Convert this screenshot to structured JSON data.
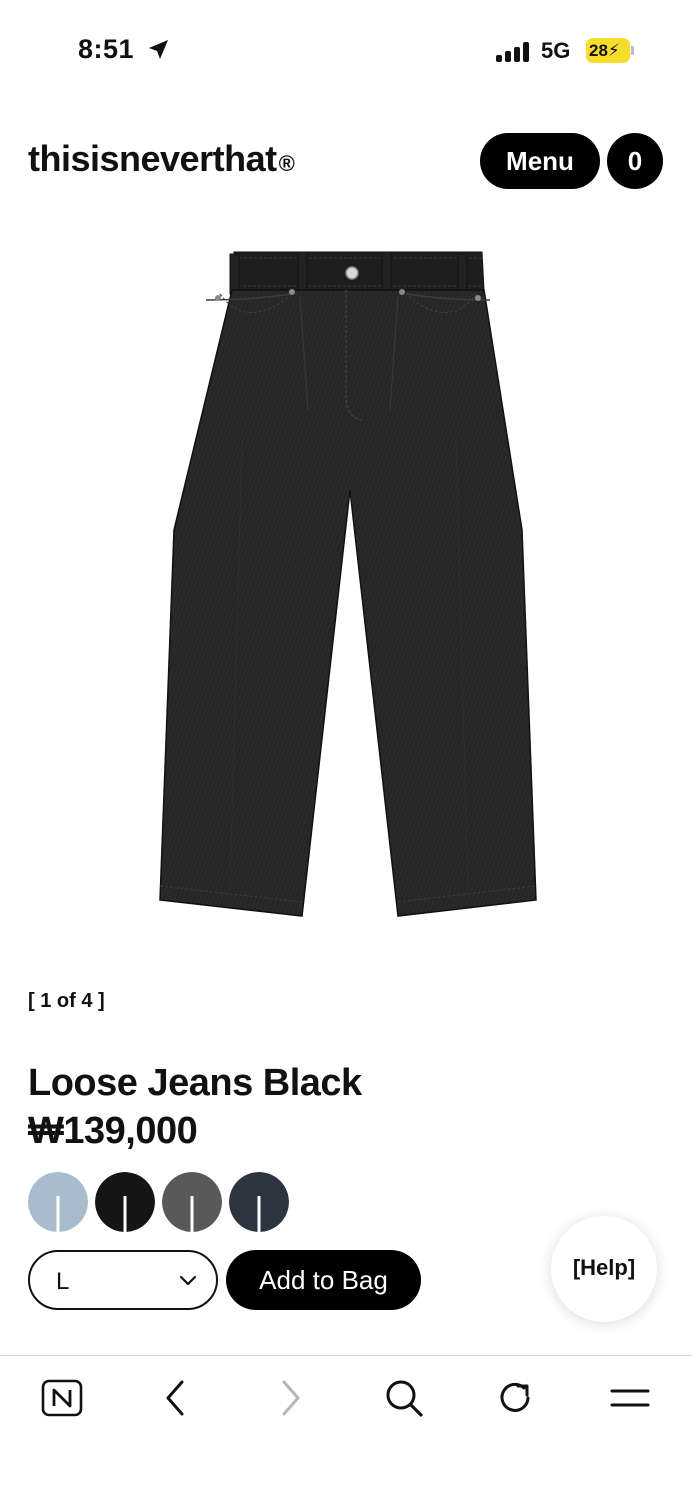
{
  "status_bar": {
    "time": "8:51",
    "network": "5G",
    "battery": "28"
  },
  "header": {
    "brand": "thisisneverthat",
    "brand_mark": "®",
    "menu_label": "Menu",
    "cart_count": "0"
  },
  "product": {
    "gallery_counter": "[ 1 of 4 ]",
    "title": "Loose Jeans Black",
    "price": "₩139,000",
    "image_icon": "black-jeans-product-photo",
    "swatch_colors": [
      "#a9bccd",
      "#151515",
      "#595959",
      "#2c3440"
    ],
    "selected_size": "L",
    "add_to_bag_label": "Add to Bag"
  },
  "help": {
    "label": "[Help]"
  },
  "browser_toolbar": {
    "icons": [
      "naver-icon",
      "back-icon",
      "forward-icon",
      "search-icon",
      "reload-icon",
      "hamburger-menu-icon"
    ]
  },
  "colors": {
    "primary": "#000000",
    "background": "#ffffff",
    "battery": "#f6dd2c"
  }
}
